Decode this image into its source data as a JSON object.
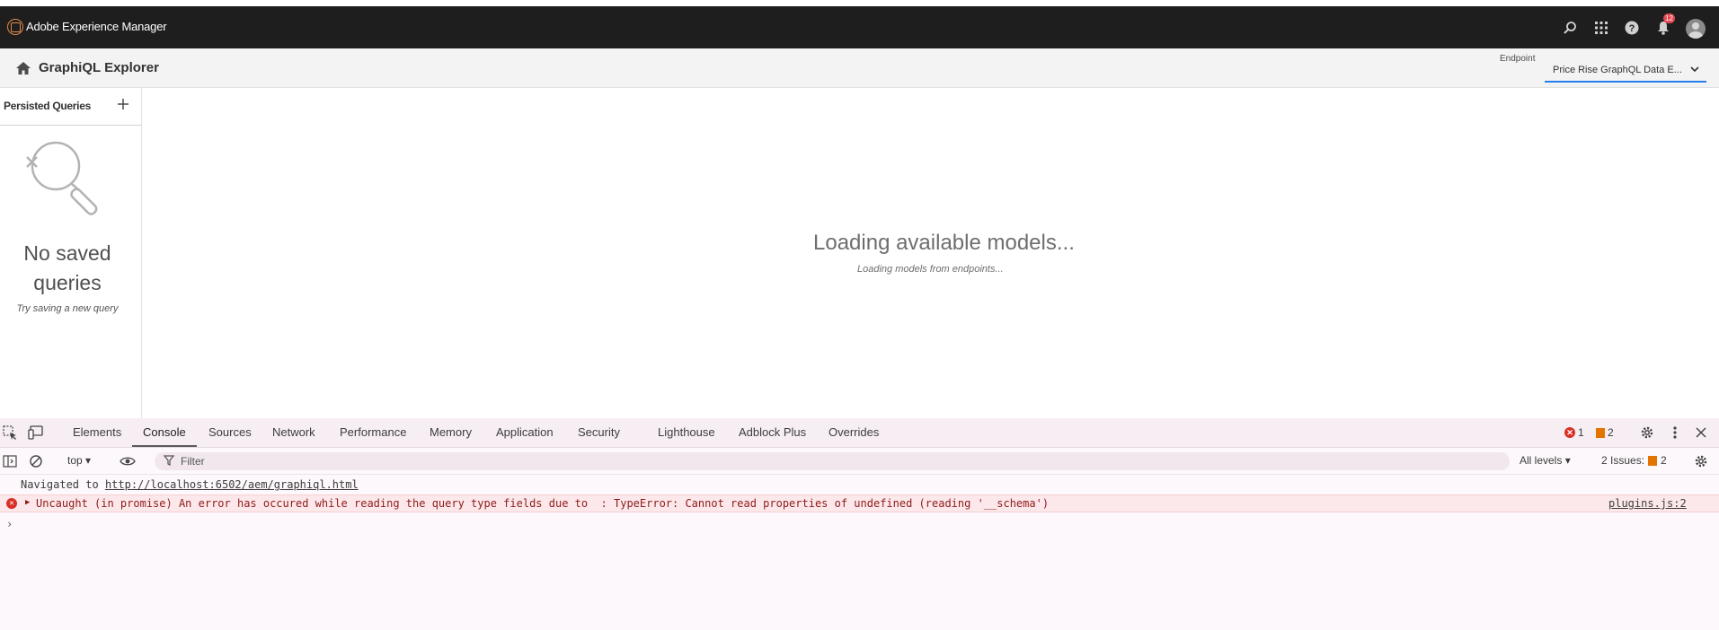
{
  "aem_header": {
    "title": "Adobe Experience Manager",
    "notification_count": "12",
    "icons": [
      "search-icon",
      "apps-grid-icon",
      "help-icon",
      "bell-icon",
      "avatar"
    ]
  },
  "graphiql_bar": {
    "title": "GraphiQL Explorer",
    "endpoint_label": "Endpoint",
    "endpoint_value": "Price Rise GraphQL Data E..."
  },
  "sidebar": {
    "title": "Persisted Queries",
    "empty_title": "No saved queries",
    "empty_subtitle": "Try saving a new query"
  },
  "main": {
    "loading_title": "Loading available models...",
    "loading_subtitle": "Loading models from endpoints..."
  },
  "devtools": {
    "tabs": [
      "Elements",
      "Console",
      "Sources",
      "Network",
      "Performance",
      "Memory",
      "Application",
      "Security",
      "Lighthouse",
      "Adblock Plus",
      "Overrides"
    ],
    "active_tab": "Console",
    "error_count": "1",
    "warning_count": "2",
    "context": "top",
    "filter_placeholder": "Filter",
    "levels": "All levels",
    "issues_label": "2 Issues:",
    "issues_count": "2",
    "console": {
      "nav_prefix": "Navigated to",
      "nav_url": "http://localhost:6502/aem/graphiql.html",
      "error_message": "Uncaught (in promise) An error has occured while reading the query type fields due to  : TypeError: Cannot read properties of undefined (reading '__schema')",
      "error_source": "plugins.js:2"
    }
  },
  "colors": {
    "aem_header_bg": "#1e1e1e",
    "accent_blue": "#2680eb",
    "error_red": "#d93025",
    "warning_orange": "#e37400"
  }
}
